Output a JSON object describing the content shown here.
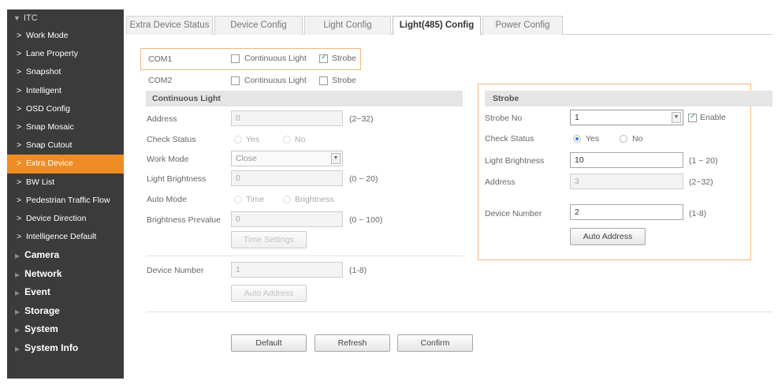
{
  "sidebar": {
    "header": "ITC",
    "sub_items": [
      {
        "label": "Work Mode"
      },
      {
        "label": "Lane Property"
      },
      {
        "label": "Snapshot"
      },
      {
        "label": "Intelligent"
      },
      {
        "label": "OSD Config"
      },
      {
        "label": "Snap Mosaic"
      },
      {
        "label": "Snap Cutout"
      },
      {
        "label": "Extra Device"
      },
      {
        "label": "BW List"
      },
      {
        "label": "Pedestrian Traffic Flow"
      },
      {
        "label": "Device Direction"
      },
      {
        "label": "Intelligence Default"
      }
    ],
    "active_item": "Extra Device",
    "top_items": [
      {
        "label": "Camera"
      },
      {
        "label": "Network"
      },
      {
        "label": "Event"
      },
      {
        "label": "Storage"
      },
      {
        "label": "System"
      },
      {
        "label": "System Info"
      }
    ]
  },
  "tabs": [
    {
      "label": "Extra Device Status"
    },
    {
      "label": "Device Config"
    },
    {
      "label": "Light Config"
    },
    {
      "label": "Light(485) Config"
    },
    {
      "label": "Power Config"
    }
  ],
  "active_tab": "Light(485) Config",
  "com1": {
    "label": "COM1",
    "continuous_light": "Continuous Light",
    "continuous_checked": false,
    "strobe": "Strobe",
    "strobe_checked": true
  },
  "com2": {
    "label": "COM2",
    "continuous_light": "Continuous Light",
    "continuous_checked": false,
    "strobe": "Strobe",
    "strobe_checked": false
  },
  "continuous": {
    "title": "Continuous Light",
    "address_label": "Address",
    "address_value": "0",
    "address_range": "(2~32)",
    "check_status_label": "Check Status",
    "yes": "Yes",
    "no": "No",
    "work_mode_label": "Work Mode",
    "work_mode_value": "Close",
    "light_brightness_label": "Light Brightness",
    "light_brightness_value": "0",
    "light_brightness_range": "(0 ~ 20)",
    "auto_mode_label": "Auto Mode",
    "time": "Time",
    "brightness": "Brightness",
    "brightness_prevalue_label": "Brightness Prevalue",
    "brightness_prevalue_value": "0",
    "brightness_prevalue_range": "(0 ~ 100)",
    "time_settings_button": "Time Settings",
    "device_number_label": "Device Number",
    "device_number_value": "1",
    "device_number_range": "(1-8)",
    "auto_address_button": "Auto Address"
  },
  "strobe": {
    "title": "Strobe",
    "strobe_no_label": "Strobe No",
    "strobe_no_value": "1",
    "enable_label": "Enable",
    "enable_checked": true,
    "check_status_label": "Check Status",
    "yes": "Yes",
    "no": "No",
    "check_status_value": "Yes",
    "light_brightness_label": "Light Brightness",
    "light_brightness_value": "10",
    "light_brightness_range": "(1 ~ 20)",
    "address_label": "Address",
    "address_value": "3",
    "address_range": "(2~32)",
    "device_number_label": "Device Number",
    "device_number_value": "2",
    "device_number_range": "(1-8)",
    "auto_address_button": "Auto Address"
  },
  "footer": {
    "default_button": "Default",
    "refresh_button": "Refresh",
    "confirm_button": "Confirm"
  },
  "colors": {
    "sidebar_bg": "#3b3b3b",
    "active_orange": "#f08c24",
    "highlight_box": "#f4b77e"
  }
}
